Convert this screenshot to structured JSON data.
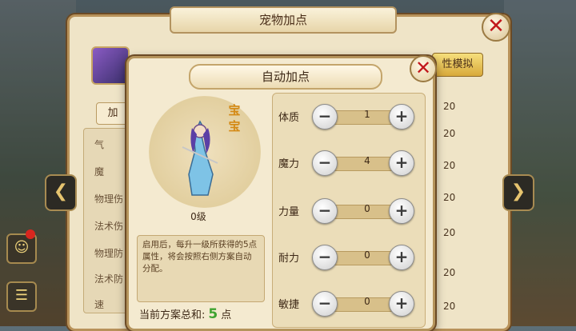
{
  "main_window": {
    "title": "宠物加点",
    "tab_label": "加",
    "sim_button": "性模拟",
    "stat_labels": [
      "气",
      "魔",
      "物理伤",
      "法术伤",
      "物理防",
      "法术防",
      "速"
    ],
    "right_values": [
      "20",
      "20",
      "20",
      "20",
      "20",
      "20",
      "20"
    ]
  },
  "dialog": {
    "title": "自动加点",
    "pet_name": "宝宝",
    "pet_level": "0级",
    "description": "启用后，每升一级所获得的5点属性，将会按照右侧方案自动分配。",
    "total_label": "当前方案总和:",
    "total_value": "5",
    "total_unit": "点",
    "attributes": [
      {
        "label": "体质",
        "value": "1"
      },
      {
        "label": "魔力",
        "value": "4"
      },
      {
        "label": "力量",
        "value": "0"
      },
      {
        "label": "耐力",
        "value": "0"
      },
      {
        "label": "敏捷",
        "value": "0"
      }
    ]
  }
}
